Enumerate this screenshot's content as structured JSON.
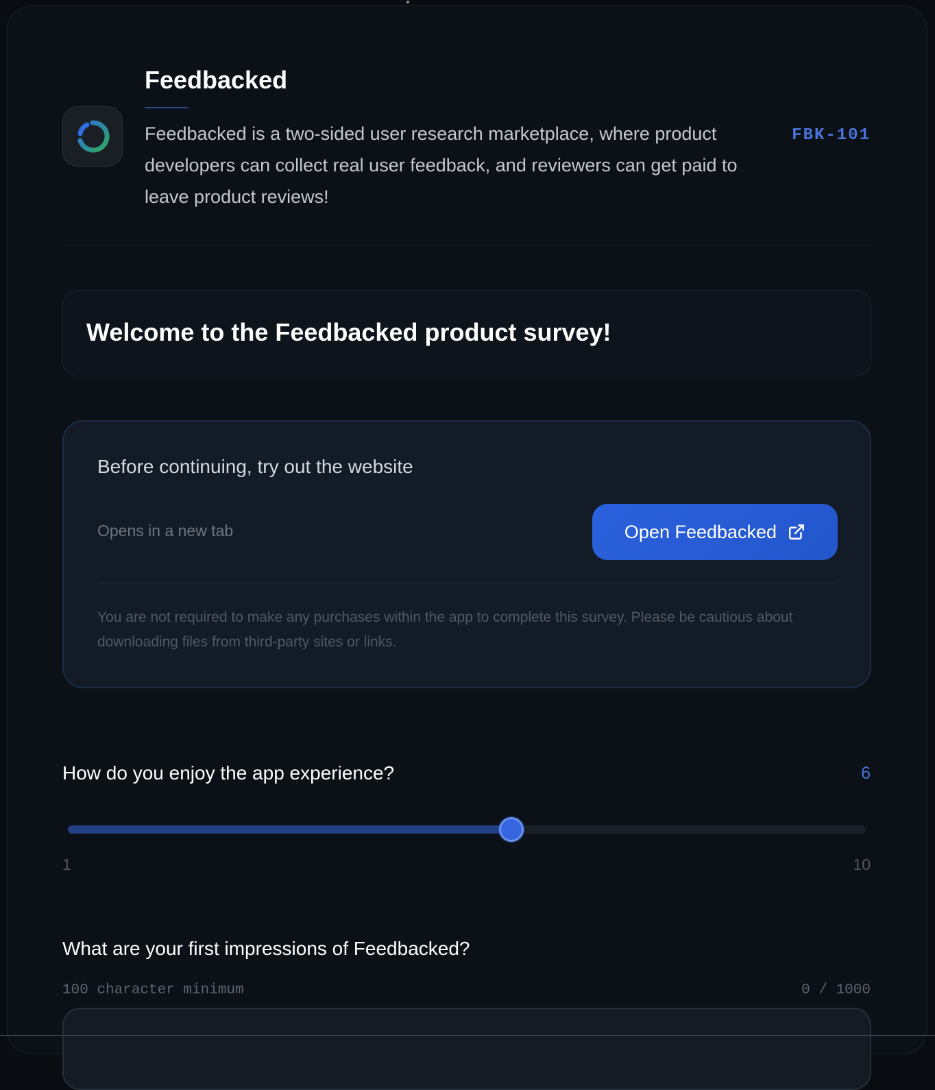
{
  "app": {
    "name": "Feedbacked",
    "description": "Feedbacked is a two-sided user research marketplace, where product developers can collect real user feedback, and reviewers can get paid to leave product reviews!",
    "code": "FBK-101"
  },
  "welcome": {
    "title": "Welcome to the Feedbacked product survey!"
  },
  "website_card": {
    "heading": "Before continuing, try out the website",
    "note": "Opens in a new tab",
    "button_label": "Open Feedbacked",
    "button_icon": "external-link-icon",
    "disclaimer": "You are not required to make any purchases within the app to complete this survey. Please be cautious about downloading files from third-party sites or links."
  },
  "question_rating": {
    "label": "How do you enjoy the app experience?",
    "value": 6,
    "value_text": "6",
    "min": 1,
    "max": 10,
    "min_label": "1",
    "max_label": "10"
  },
  "question_text": {
    "label": "What are your first impressions of Feedbacked?",
    "hint": "100 character minimum",
    "counter": "0 / 1000",
    "value": ""
  },
  "colors": {
    "accent": "#3566df",
    "code_text": "#4a72d9",
    "background": "#0b1117",
    "logo_ring_blue": "#2f6ee0",
    "logo_ring_green": "#2fa860"
  }
}
